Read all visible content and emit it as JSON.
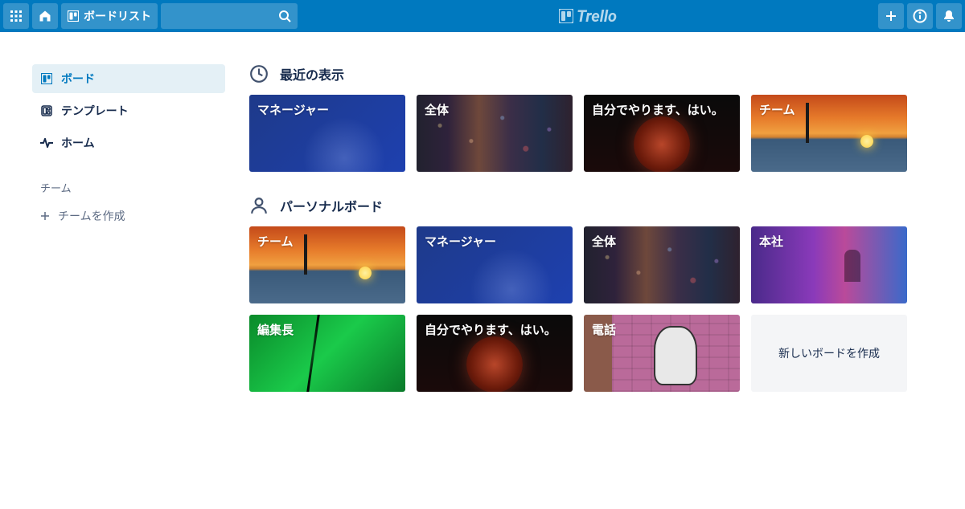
{
  "header": {
    "boards_button": "ボードリスト"
  },
  "logo": "Trello",
  "sidebar": {
    "nav": [
      {
        "label": "ボード",
        "icon": "board"
      },
      {
        "label": "テンプレート",
        "icon": "template"
      },
      {
        "label": "ホーム",
        "icon": "pulse"
      }
    ],
    "team_label": "チーム",
    "create_team": "チームを作成"
  },
  "sections": {
    "recent": {
      "title": "最近の表示",
      "boards": [
        {
          "title": "マネージャー",
          "bg": "bg-blue"
        },
        {
          "title": "全体",
          "bg": "bg-city"
        },
        {
          "title": "自分でやります、はい。",
          "bg": "bg-moon"
        },
        {
          "title": "チーム",
          "bg": "bg-sunset"
        }
      ]
    },
    "personal": {
      "title": "パーソナルボード",
      "boards": [
        {
          "title": "チーム",
          "bg": "bg-sunset"
        },
        {
          "title": "マネージャー",
          "bg": "bg-blue"
        },
        {
          "title": "全体",
          "bg": "bg-city"
        },
        {
          "title": "本社",
          "bg": "bg-neon"
        },
        {
          "title": "編集長",
          "bg": "bg-green"
        },
        {
          "title": "自分でやります、はい。",
          "bg": "bg-moon"
        },
        {
          "title": "電話",
          "bg": "bg-mural"
        }
      ],
      "create_label": "新しいボードを作成"
    }
  }
}
